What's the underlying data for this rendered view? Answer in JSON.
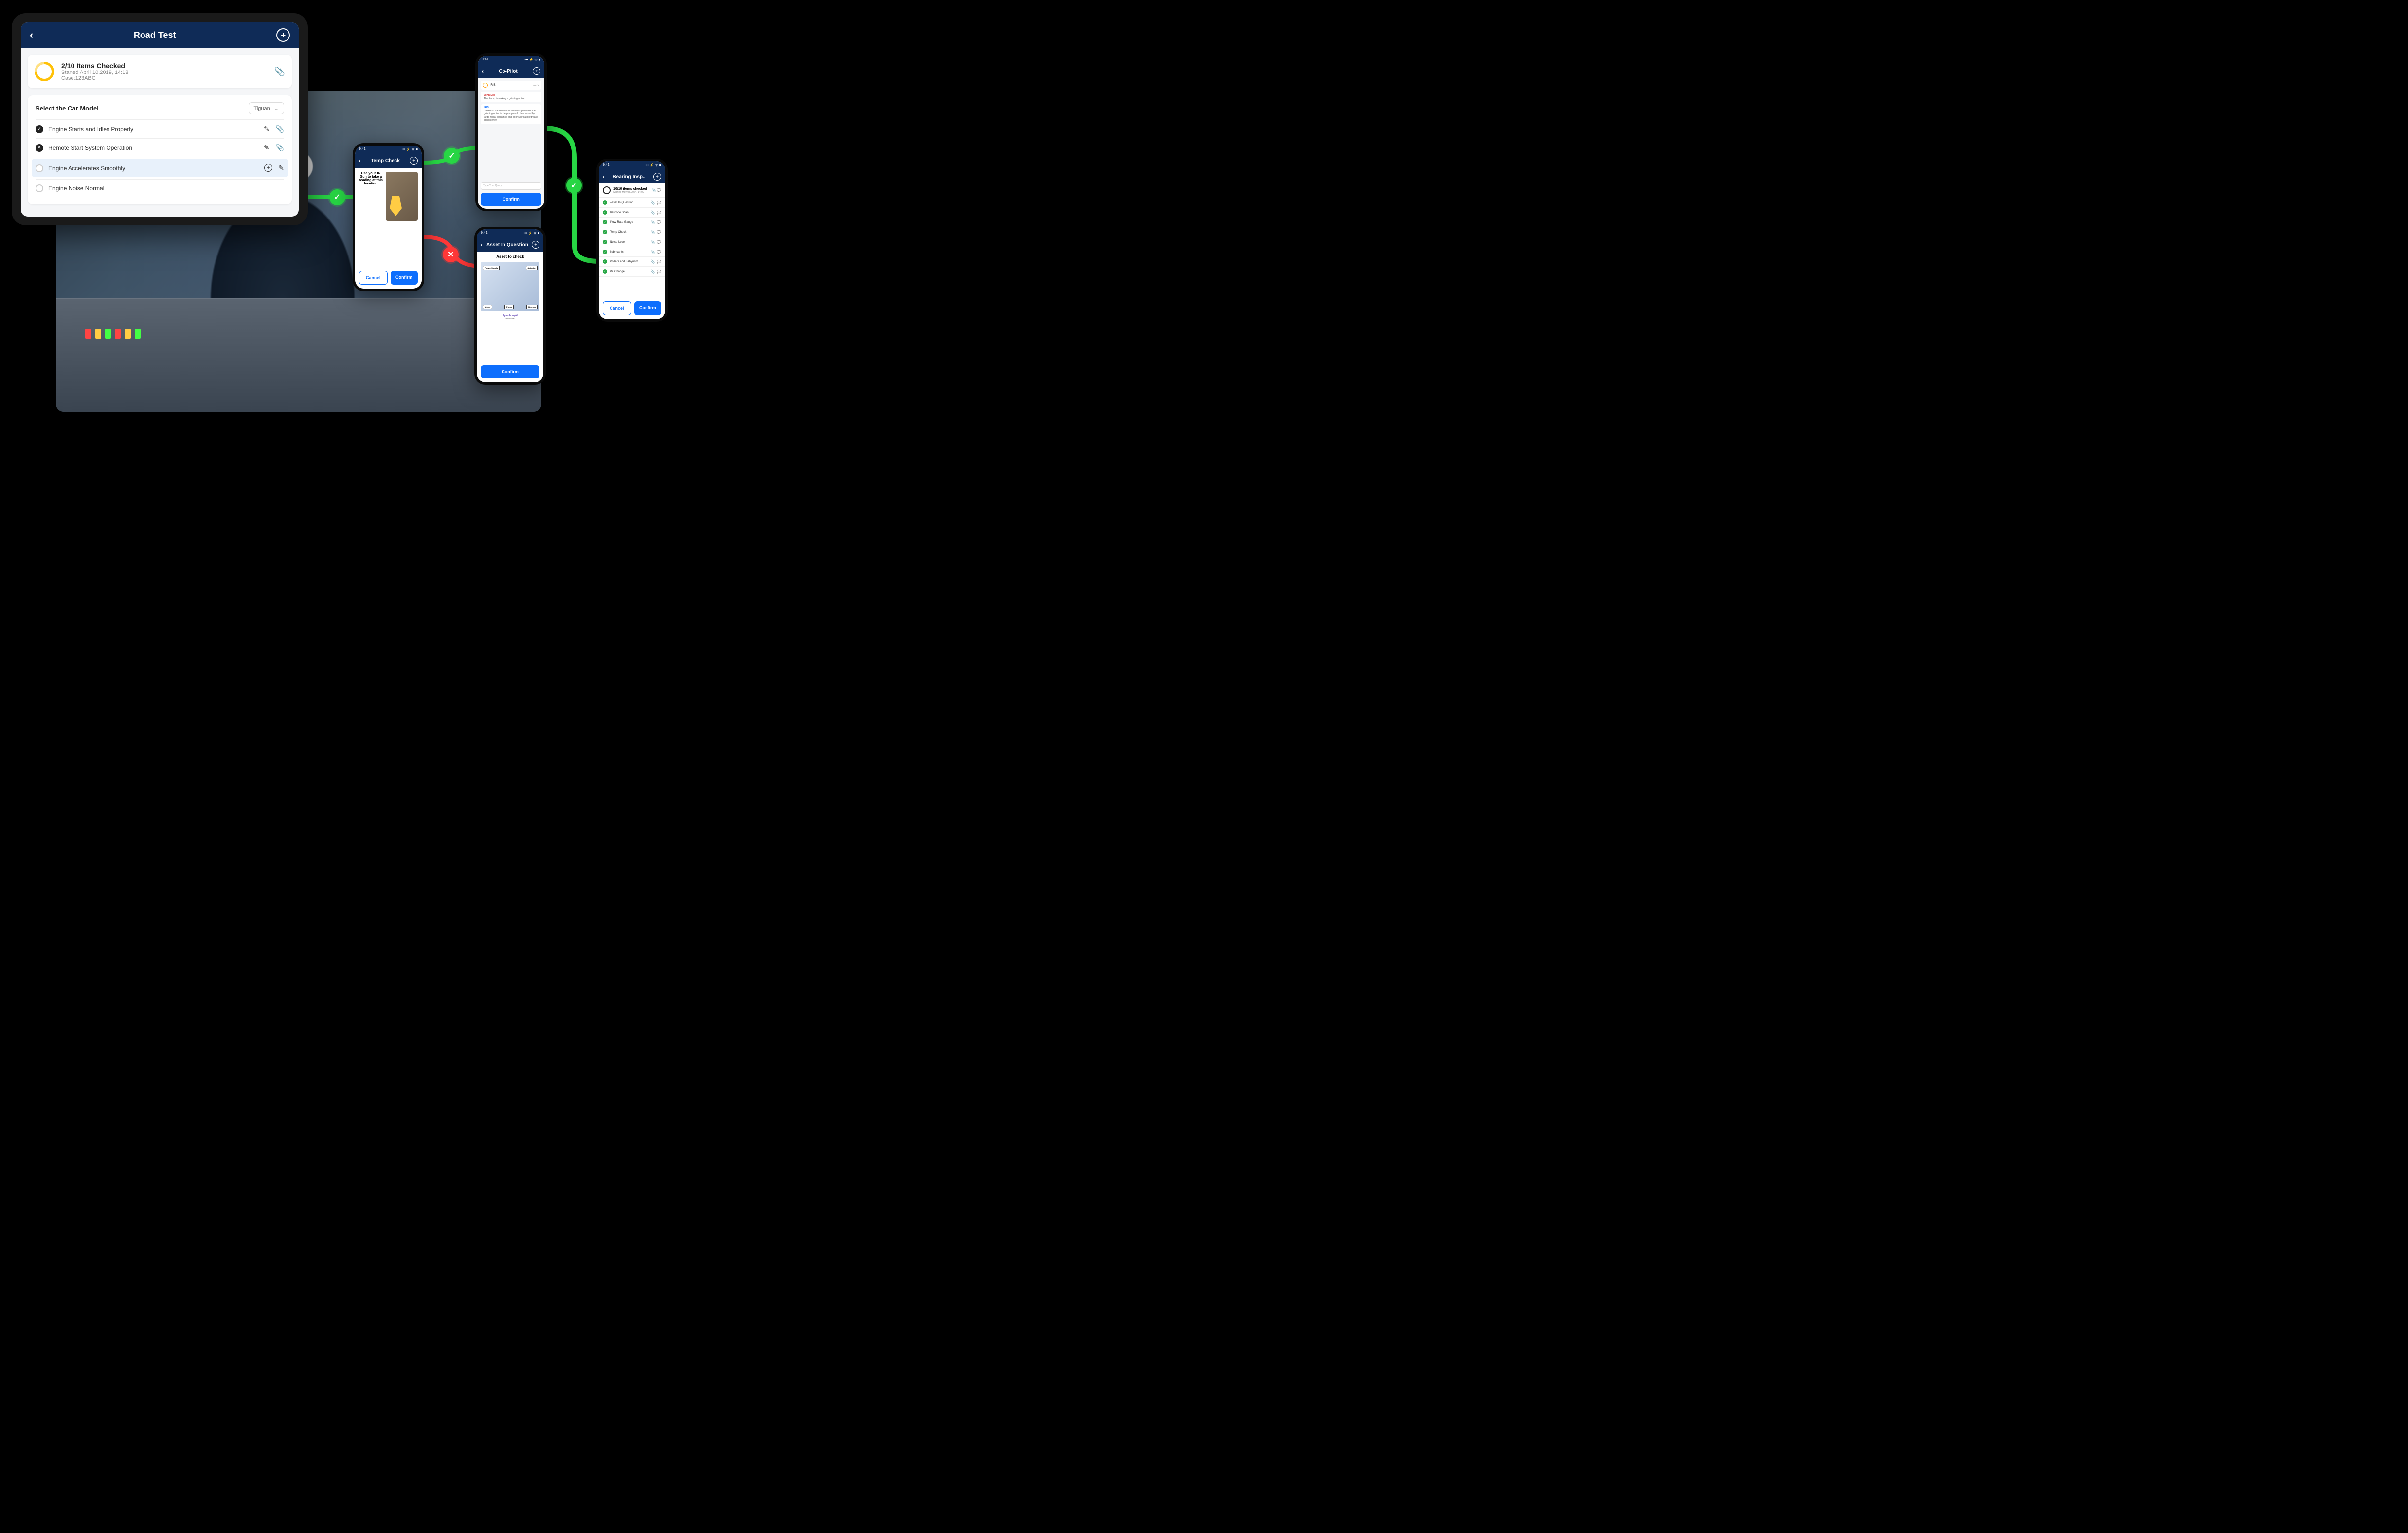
{
  "status_bar": {
    "time": "9:41",
    "indicators": "••• ⚡ ᯤ ■"
  },
  "tablet": {
    "title": "Road Test",
    "progress": {
      "counter": "2/10 Items Checked",
      "started": "Started April 10,2019, 14:18",
      "case": "Case:123ABC"
    },
    "form_label": "Select the Car Model",
    "dropdown_value": "Tiguan",
    "items": [
      {
        "label": "Engine Starts and Idles Properly",
        "status": "check"
      },
      {
        "label": "Remote Start System Operation",
        "status": "x"
      },
      {
        "label": "Engine Accelerates Smoothly",
        "status": "empty",
        "highlight": true
      },
      {
        "label": "Engine Noise Normal",
        "status": "empty"
      }
    ]
  },
  "phone_temp": {
    "title": "Temp Check",
    "instruction": "Use your IR Gun to take a reading at this location",
    "cancel": "Cancel",
    "confirm": "Confirm"
  },
  "phone_copilot": {
    "title": "Co-Pilot",
    "iris_label": "IRIS",
    "msg1_sender": "John Doe",
    "msg1_text": "The Pump is making a grinding noise.",
    "msg2_sender": "IRIS",
    "msg2_text": "Based on the relevant documents provided, the grinding noise in the pump could be caused by large radial clearance and poor lubrication/grease consistency.",
    "input_placeholder": "Type Your Query",
    "confirm": "Confirm"
  },
  "phone_asset": {
    "title": "Asset In Question",
    "subtitle": "Asset to check",
    "labels": {
      "power": "Power Supply",
      "actuator": "Actuator",
      "motor": "Motor",
      "pump": "Pump",
      "bearing": "Bearing"
    },
    "brand": "SymphonyAI",
    "brand_sub": "Industrial",
    "confirm": "Confirm"
  },
  "phone_bearing": {
    "title": "Bearing Insp..",
    "progress": {
      "counter": "10/10 items checked",
      "started": "Started May 08,2024, 14:00"
    },
    "items": [
      "Asset In Question",
      "Barcode Scan",
      "Flow Rate Gauge",
      "Temp Check",
      "Noise Level",
      "Lubricants",
      "Collars and Labyrinth",
      "Oil Change"
    ],
    "cancel": "Cancel",
    "confirm": "Confirm"
  }
}
